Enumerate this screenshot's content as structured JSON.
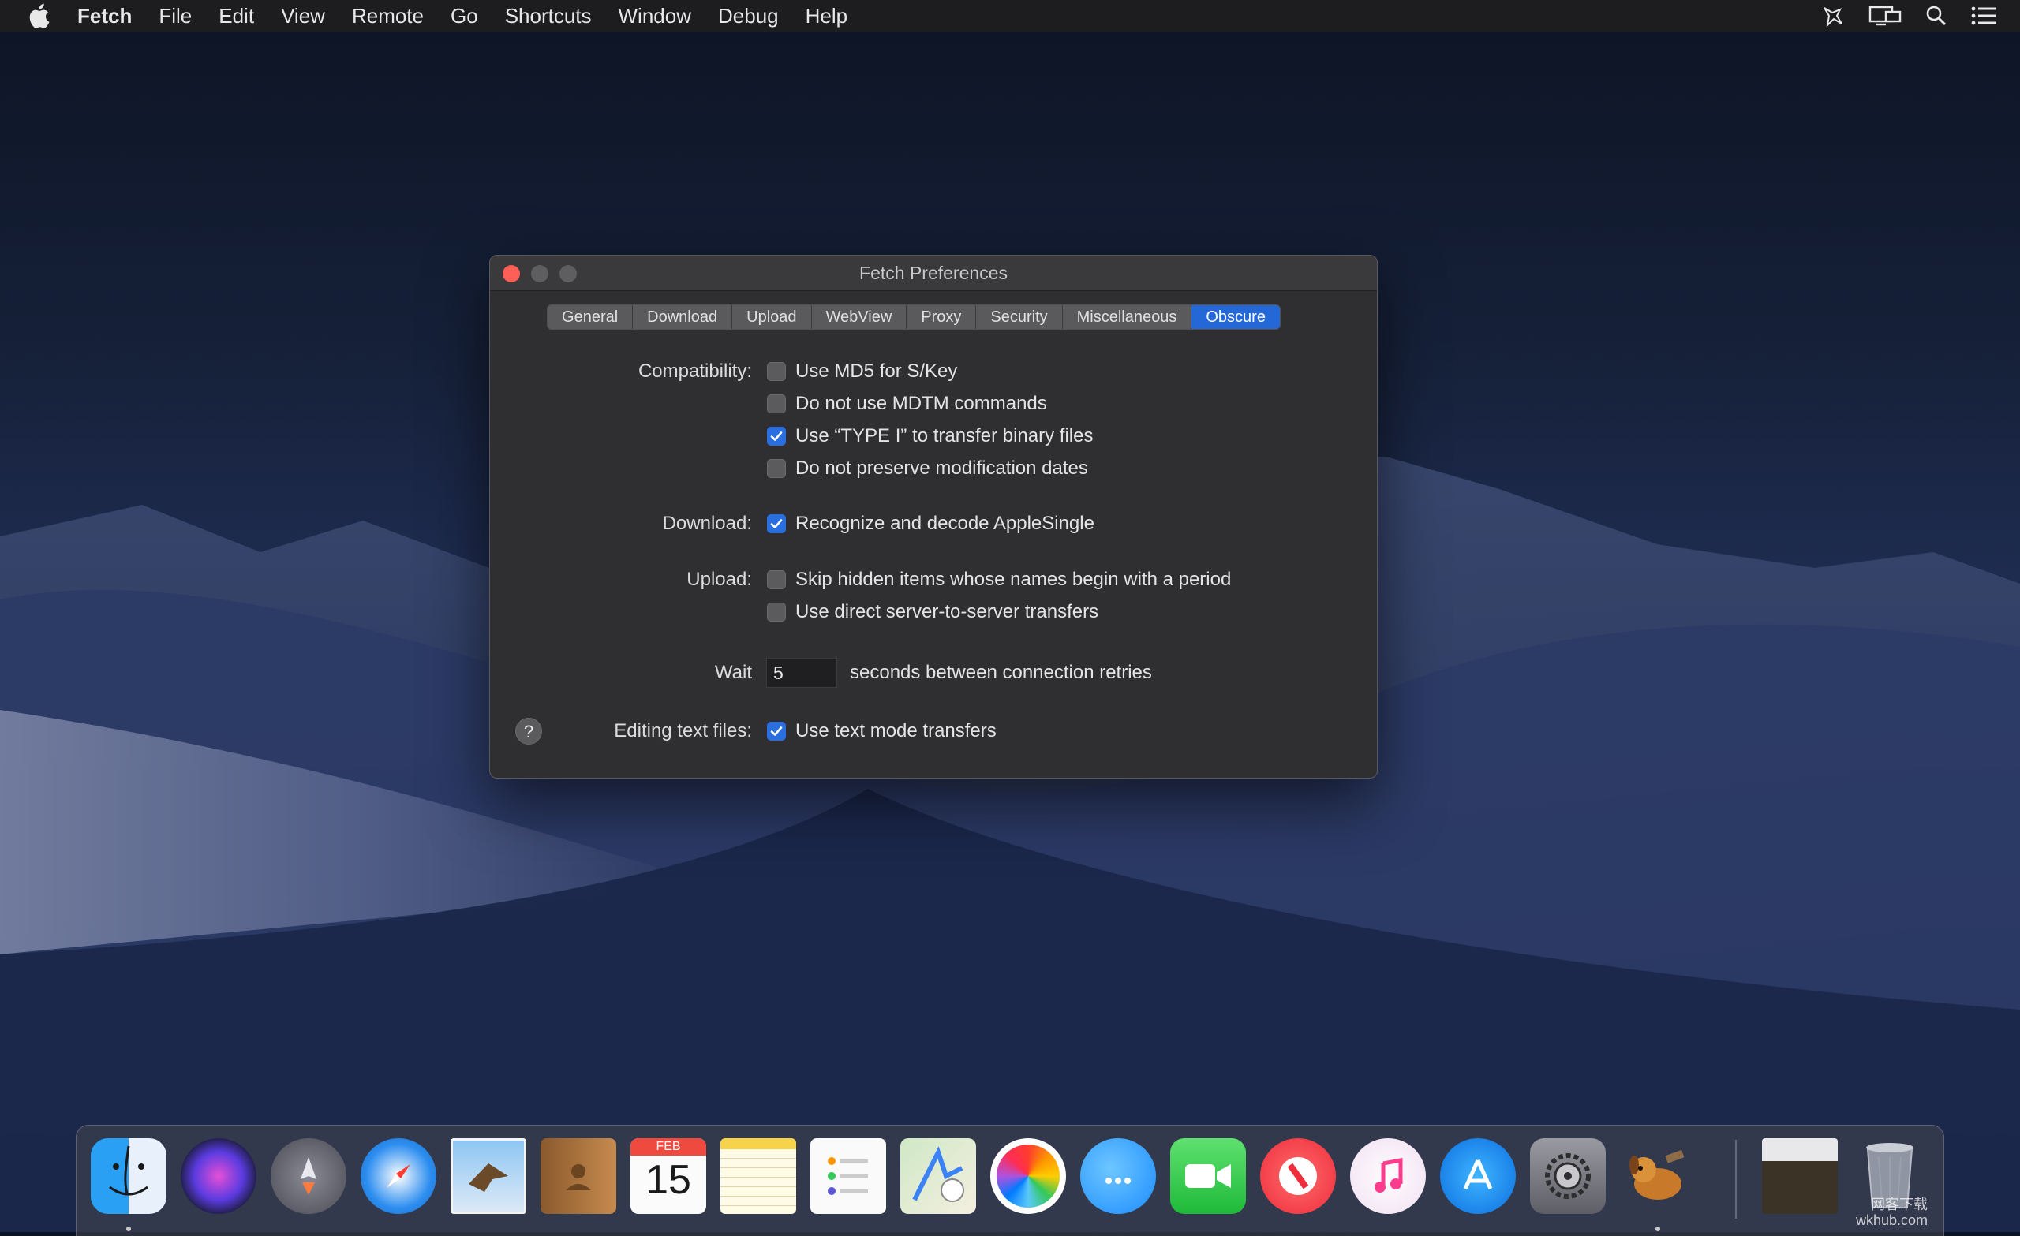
{
  "menubar": {
    "app_name": "Fetch",
    "items": [
      "File",
      "Edit",
      "View",
      "Remote",
      "Go",
      "Shortcuts",
      "Window",
      "Debug",
      "Help"
    ],
    "status_icons": [
      "fetch-dog-icon",
      "display-mirror-icon",
      "spotlight-search-icon",
      "notification-center-icon"
    ]
  },
  "window": {
    "title": "Fetch Preferences",
    "tabs": [
      "General",
      "Download",
      "Upload",
      "WebView",
      "Proxy",
      "Security",
      "Miscellaneous",
      "Obscure"
    ],
    "active_tab": "Obscure",
    "sections": {
      "compatibility": {
        "label": "Compatibility:",
        "options": [
          {
            "text": "Use MD5 for S/Key",
            "checked": false
          },
          {
            "text": "Do not use MDTM commands",
            "checked": false
          },
          {
            "text": "Use “TYPE I” to transfer binary files",
            "checked": true
          },
          {
            "text": "Do not preserve modification dates",
            "checked": false
          }
        ]
      },
      "download": {
        "label": "Download:",
        "options": [
          {
            "text": "Recognize and decode AppleSingle",
            "checked": true
          }
        ]
      },
      "upload": {
        "label": "Upload:",
        "options": [
          {
            "text": "Skip hidden items whose names begin with a period",
            "checked": false
          },
          {
            "text": "Use direct server-to-server transfers",
            "checked": false
          }
        ]
      },
      "wait": {
        "label": "Wait",
        "value": "5",
        "suffix": "seconds between connection retries"
      },
      "editing": {
        "label": "Editing text files:",
        "options": [
          {
            "text": "Use text mode transfers",
            "checked": true
          }
        ]
      }
    },
    "help_label": "?"
  },
  "dock": {
    "icons": [
      "finder-icon",
      "siri-icon",
      "launchpad-icon",
      "safari-icon",
      "mail-icon",
      "contacts-icon",
      "calendar-icon",
      "notes-icon",
      "reminders-icon",
      "maps-icon",
      "photos-icon",
      "messages-icon",
      "facetime-icon",
      "news-icon",
      "itunes-icon",
      "app-store-icon",
      "system-preferences-icon",
      "fetch-icon",
      "downloads-stack-icon",
      "trash-icon"
    ],
    "calendar_month": "FEB",
    "calendar_day": "15"
  },
  "watermark": {
    "line1": "网客下载",
    "line2": "wkhub.com"
  },
  "colors": {
    "accent": "#2467d6",
    "close": "#fe5f57"
  }
}
